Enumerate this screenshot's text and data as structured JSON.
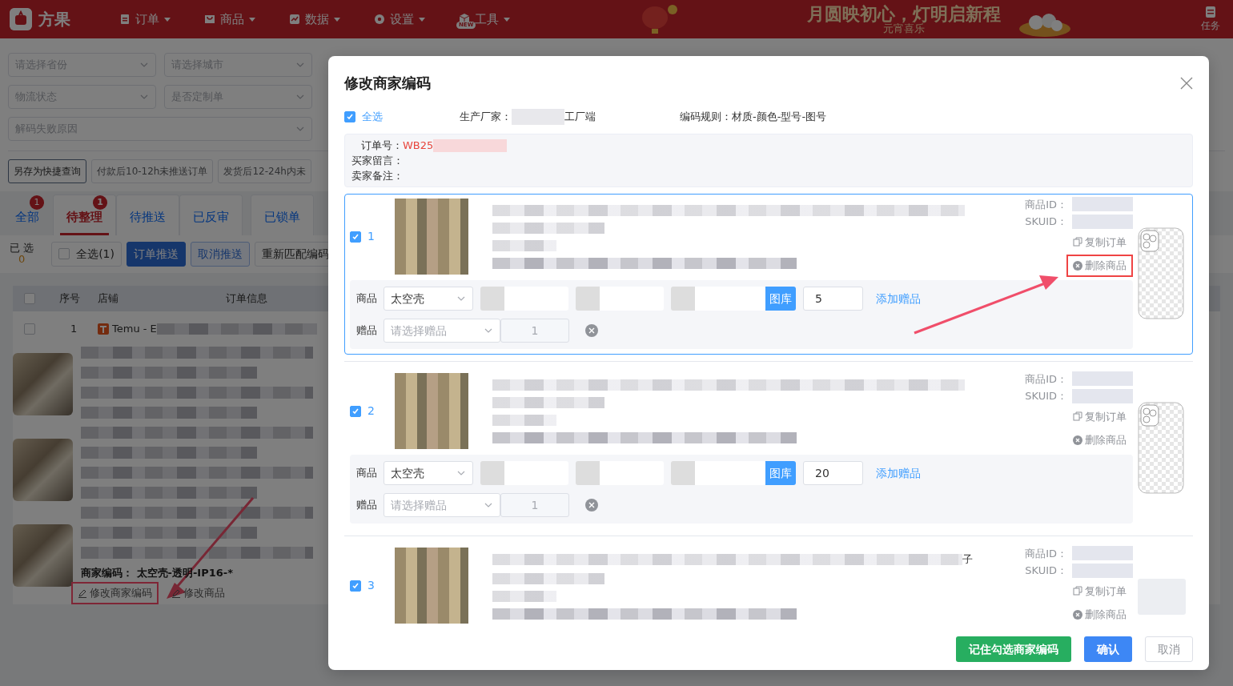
{
  "navbar": {
    "brand": "方果",
    "menus": [
      {
        "label": "订单"
      },
      {
        "label": "商品"
      },
      {
        "label": "数据"
      },
      {
        "label": "设置"
      },
      {
        "label": "工具",
        "badge": "NEW"
      }
    ],
    "banner": {
      "title": "月圆映初心，灯明启新程",
      "subtitle": "元宵喜乐"
    },
    "task": "任务"
  },
  "filters": [
    {
      "placeholder": "请选择省份"
    },
    {
      "placeholder": "请选择城市"
    },
    {
      "placeholder": "物流状态"
    },
    {
      "placeholder": "是否定制单"
    },
    {
      "placeholder": "解码失败原因"
    }
  ],
  "quick_buttons": [
    {
      "label": "另存为快捷查询",
      "kind": "outline"
    },
    {
      "label": "付款后10-12h未推送订单",
      "kind": "plain"
    },
    {
      "label": "发货后12-24h内未",
      "kind": "plain"
    }
  ],
  "status_tabs": [
    {
      "label": "全部",
      "count": "1",
      "selected": false
    },
    {
      "label": "待整理",
      "count": "1",
      "selected": true
    },
    {
      "label": "待推送",
      "selected": false
    },
    {
      "label": "已反审",
      "selected": false
    },
    {
      "label": "已锁单",
      "selected": false
    }
  ],
  "selection": {
    "label": "已 选",
    "count": "0"
  },
  "select_all": {
    "label": "全选(1)",
    "checked": false
  },
  "actions": [
    {
      "label": "订单推送",
      "kind": "primary"
    },
    {
      "label": "取消推送",
      "kind": "outline"
    },
    {
      "label": "重新匹配编码",
      "kind": "plain"
    }
  ],
  "table": {
    "select_all_checked": false,
    "columns": [
      "序号",
      "店铺",
      "订单信息"
    ],
    "rows": [
      {
        "checked": false,
        "index": "1",
        "shop": "Temu - E",
        "merchant_code_label": "商家编码：",
        "merchant_code": "太空壳-透明-IP16-*",
        "links": [
          {
            "label": "修改商家编码",
            "highlighted": true
          },
          {
            "label": "修改商品",
            "highlighted": false
          }
        ]
      }
    ]
  },
  "modal": {
    "title": "修改商家编码",
    "select_all": {
      "label": "全选",
      "checked": true
    },
    "manufacturer_label": "生产厂家：",
    "manufacturer_suffix": "工厂端",
    "rule": "编码规则：材质-颜色-型号-图号",
    "order": {
      "number_label": "订单号：",
      "number": "WB25",
      "buyer_note_label": "买家留言：",
      "seller_note_label": "卖家备注："
    },
    "items": [
      {
        "index": "1",
        "checked": true,
        "selected": true,
        "product_id_label": "商品ID：",
        "skuid_label": "SKUID：",
        "copy": "复制订单",
        "delete": "删除商品",
        "delete_highlighted": true,
        "kind": "case",
        "form": {
          "product_label": "商品",
          "product": "太空壳",
          "gallery": "图库",
          "quantity": "5",
          "add_gift": "添加赠品",
          "gift_label": "赠品",
          "gift_placeholder": "请选择赠品",
          "gift_quantity": "1"
        }
      },
      {
        "index": "2",
        "checked": true,
        "selected": false,
        "product_id_label": "商品ID：",
        "skuid_label": "SKUID：",
        "copy": "复制订单",
        "delete": "删除商品",
        "delete_highlighted": false,
        "kind": "case",
        "form": {
          "product_label": "商品",
          "product": "太空壳",
          "gallery": "图库",
          "quantity": "20",
          "add_gift": "添加赠品",
          "gift_label": "赠品",
          "gift_placeholder": "请选择赠品",
          "gift_quantity": "1"
        }
      },
      {
        "index": "3",
        "checked": true,
        "selected": false,
        "title_tail": "子",
        "product_id_label": "商品ID：",
        "skuid_label": "SKUID：",
        "copy": "复制订单",
        "delete": "删除商品",
        "delete_highlighted": false,
        "kind": "empty"
      }
    ],
    "buttons": [
      {
        "label": "记住勾选商家编码",
        "kind": "success"
      },
      {
        "label": "确认",
        "kind": "primary"
      },
      {
        "label": "取消",
        "kind": "plain"
      }
    ]
  }
}
